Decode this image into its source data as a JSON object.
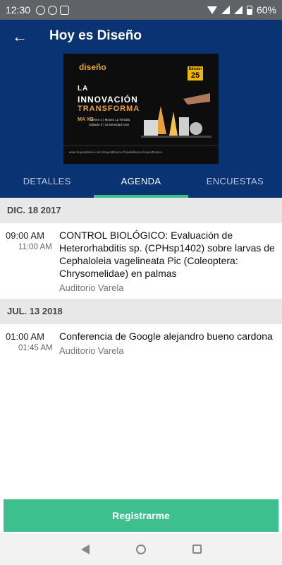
{
  "status_bar": {
    "time": "12:30",
    "battery": "60%"
  },
  "header": {
    "title": "Hoy es Diseño",
    "back_icon": "arrow-left-icon"
  },
  "banner": {
    "logo": "diseño",
    "badge_top": "Edición",
    "badge_num": "25",
    "line1": "LA",
    "line2": "INNOVACIÓN",
    "line3": "TRANSFORMA",
    "month": "MA YO",
    "dates_1": "Viernes 4 | Museo La Tertulia",
    "dates_2": "Sábado 5 | Universidad Icesi",
    "footer": "www.hoyesdiseno.com   /HoyesDiseno   /hoyesdiseno   /HoyesDiseno"
  },
  "tabs": [
    {
      "label": "DETALLES",
      "active": false
    },
    {
      "label": "AGENDA",
      "active": true
    },
    {
      "label": "ENCUESTAS",
      "active": false
    }
  ],
  "agenda": [
    {
      "date": "DIC. 18 2017",
      "events": [
        {
          "start": "09:00 AM",
          "end": "11:00 AM",
          "title": "CONTROL BIOLÓGICO: Evaluación de Heterorhabditis sp. (CPHsp1402) sobre larvas de Cephaloleia vagelineata Pic (Coleoptera: Chrysomelidae) en palmas",
          "location": "Auditorio Varela"
        }
      ]
    },
    {
      "date": "JUL. 13 2018",
      "events": [
        {
          "start": "01:00 AM",
          "end": "01:45 AM",
          "title": "Conferencia de Google alejandro bueno cardona",
          "location": "Auditorio Varela"
        }
      ]
    }
  ],
  "register_button": {
    "label": "Registrarme"
  },
  "colors": {
    "primary": "#0a3374",
    "accent": "#3dbf8e",
    "date_header_bg": "#e8e8e8"
  }
}
